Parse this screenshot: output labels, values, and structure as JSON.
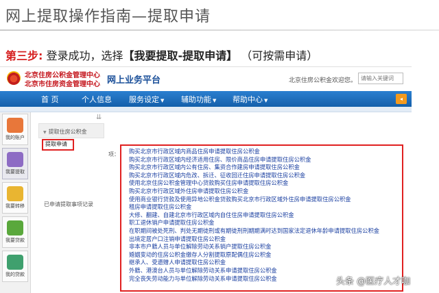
{
  "slide": {
    "title": "网上提取操作指南—提取申请",
    "step_label": "第三步:",
    "step_text": "登录成功，选择",
    "step_strong": "【我要提取-提取申请】",
    "step_note": "（可按需申请）"
  },
  "site": {
    "org_line1": "北京住房公积金管理中心",
    "org_line2": "北京市住房资金管理中心",
    "platform": "网上业务平台",
    "welcome": "北京住房公积金欢迎您。",
    "search_placeholder": "请输入关键词"
  },
  "nav": {
    "items": [
      {
        "label": "首  页"
      },
      {
        "label": "个人信息"
      },
      {
        "label": "服务设定"
      },
      {
        "label": "辅助功能"
      },
      {
        "label": "帮助中心"
      }
    ],
    "tab_arrow": "◂"
  },
  "rail": {
    "items": [
      {
        "label": "我的账户",
        "color": "#e8773a"
      },
      {
        "label": "我要提取",
        "color": "#8d6bc4"
      },
      {
        "label": "我要转移",
        "color": "#e9b531"
      },
      {
        "label": "我要贷款",
        "color": "#5aa83c"
      },
      {
        "label": "我的贷款",
        "color": "#3fa06e"
      }
    ]
  },
  "submenu": {
    "expand": "⇊",
    "group": "提取住房公积金",
    "active_item": "提取申请",
    "item": "已申请提取事项记录"
  },
  "content": {
    "label": "项：",
    "options": [
      "购买北京市行政区域内商品住房申请提取住房公积金",
      "购买北京市行政区域内经济适用住房、限价商品住房申请提取住房公积金",
      "购买北京市行政区域内公有住房、集资合作建房申请提取住房公积金",
      "购买北京市行政区域内危改、拆迁、征收回迁住房申请提取住房公积金",
      "使用北京住房公积金管理中心贷款购买住房申请提取住房公积金",
      "购买北京市行政区域外住房申请提取住房公积金",
      "使用商业银行贷款及使用异地公积金贷款购买北京市行政区域外住房申请提取住房公积金",
      "租房申请提取住房公积金",
      "大修、翻建、自建北京市行政区域内自住住房申请提取住房公积金",
      "职工退休销户申请提取住房公积金",
      "在职期间被处死刑、判处无期徒刑或有期徒刑刑期期满时达到国家法定退休年龄申请提取住房公积金",
      "出境定居户口注销申请提取住房公积金",
      "非本市户籍人员与单位解除劳动关系销户提取住房公积金",
      "婚姻变动的住房公积金缴存人分割提取原配偶住房公积金",
      "继承人、受遗赠人申请提取住房公积金",
      "外籍、港澳台人员与单位解除劳动关系申请提取住房公积金",
      "完全丧失劳动能力与单位解除劳动关系申请提取住房公积金"
    ]
  },
  "watermark": "头条 @医疗人才咖"
}
